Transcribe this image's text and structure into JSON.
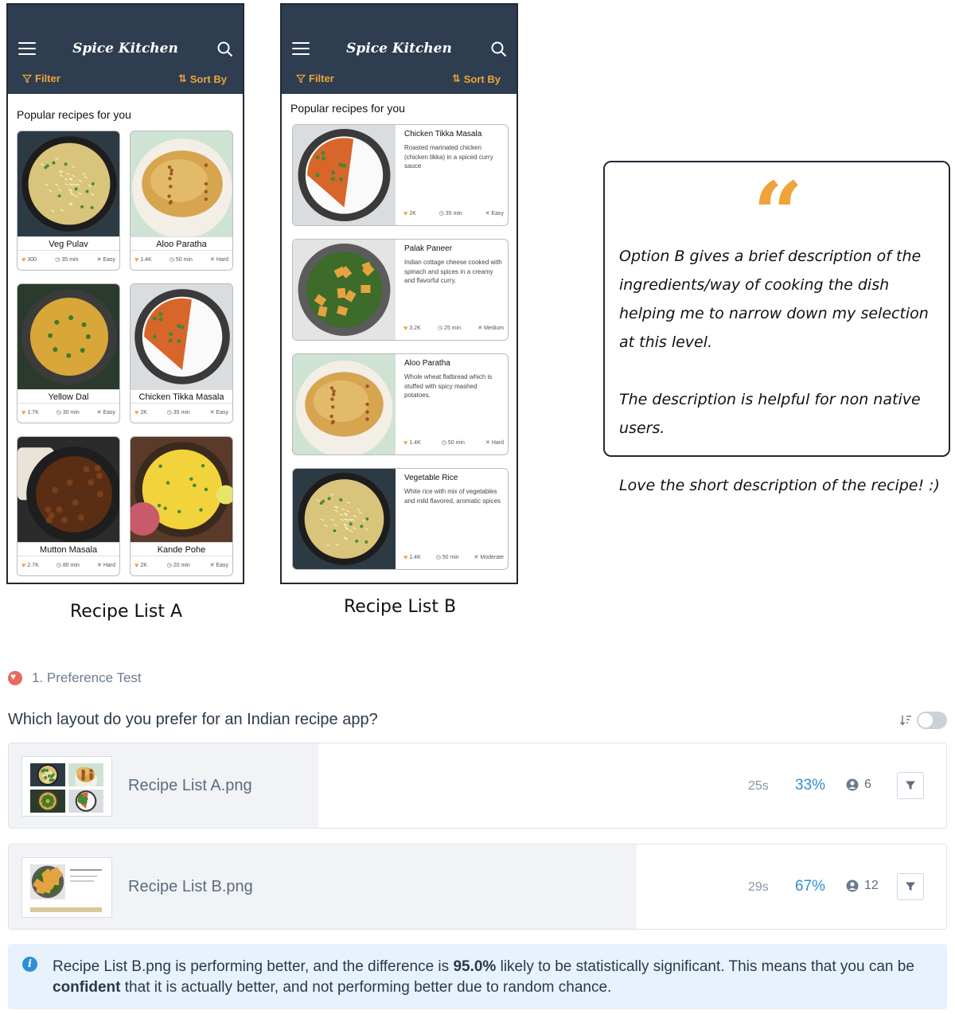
{
  "app": {
    "title": "Spice Kitchen",
    "filter_label": "Filter",
    "sort_label": "Sort By",
    "section_title": "Popular recipes for you"
  },
  "list_a": {
    "caption": "Recipe List A",
    "cards": [
      {
        "name": "Veg Pulav",
        "likes": "300",
        "time": "35 min",
        "level": "Easy",
        "img": "rice"
      },
      {
        "name": "Aloo Paratha",
        "likes": "1.4K",
        "time": "50 min",
        "level": "Hard",
        "img": "paratha"
      },
      {
        "name": "Yellow Dal",
        "likes": "1.7K",
        "time": "30 min",
        "level": "Easy",
        "img": "dal"
      },
      {
        "name": "Chicken Tikka Masala",
        "likes": "2K",
        "time": "35 min",
        "level": "Easy",
        "img": "tikka"
      },
      {
        "name": "Mutton Masala",
        "likes": "2.7K",
        "time": "80 min",
        "level": "Hard",
        "img": "mutton"
      },
      {
        "name": "Kande Pohe",
        "likes": "2K",
        "time": "20 min",
        "level": "Easy",
        "img": "pohe"
      }
    ]
  },
  "list_b": {
    "caption": "Recipe List B",
    "cards": [
      {
        "name": "Chicken Tikka Masala",
        "desc": "Roasted marinated chicken (chicken tikka) in a spiced curry sauce",
        "likes": "2K",
        "time": "35 min",
        "level": "Easy",
        "img": "tikka"
      },
      {
        "name": "Palak Paneer",
        "desc": "Indian cottage cheese cooked with spinach and spices in a creamy and flavorful curry.",
        "likes": "3.2K",
        "time": "25 min",
        "level": "Medium",
        "img": "palak"
      },
      {
        "name": "Aloo Paratha",
        "desc": "Whole wheat flatbread which is stuffed with spicy mashed potatoes.",
        "likes": "1.4K",
        "time": "50 min",
        "level": "Hard",
        "img": "paratha"
      },
      {
        "name": "Vegetable Rice",
        "desc": "White rice with mix of vegetables and mild flavored, aromatic spices",
        "likes": "1.4K",
        "time": "50 min",
        "level": "Moderate",
        "img": "rice"
      }
    ]
  },
  "quote": {
    "mark": "“",
    "line1": "Option B gives a brief description of the ingredients/way of cooking the dish helping me to narrow down my selection at this level.",
    "line2": "The description is helpful for non native users.",
    "line3": "Love the short description of the recipe! :)"
  },
  "test": {
    "label": "1. Preference Test",
    "question": "Which layout do you prefer for an Indian recipe app?",
    "results": [
      {
        "file": "Recipe List A.png",
        "time": "25s",
        "percent": "33%",
        "share": 0.33,
        "users": "6"
      },
      {
        "file": "Recipe List B.png",
        "time": "29s",
        "percent": "67%",
        "share": 0.67,
        "users": "12"
      }
    ],
    "info": {
      "part1": "Recipe List B.png is performing better, and the difference is ",
      "bold1": "95.0%",
      "part2": " likely to be statistically significant. This means that you can be ",
      "bold2": "confident",
      "part3": " that it is actually better, and not performing better due to random chance."
    }
  },
  "colors": {
    "appbar": "#2e3e50",
    "accent": "#f0a33a",
    "percent": "#2d8fd6",
    "task_dot": "#e96a5e"
  }
}
